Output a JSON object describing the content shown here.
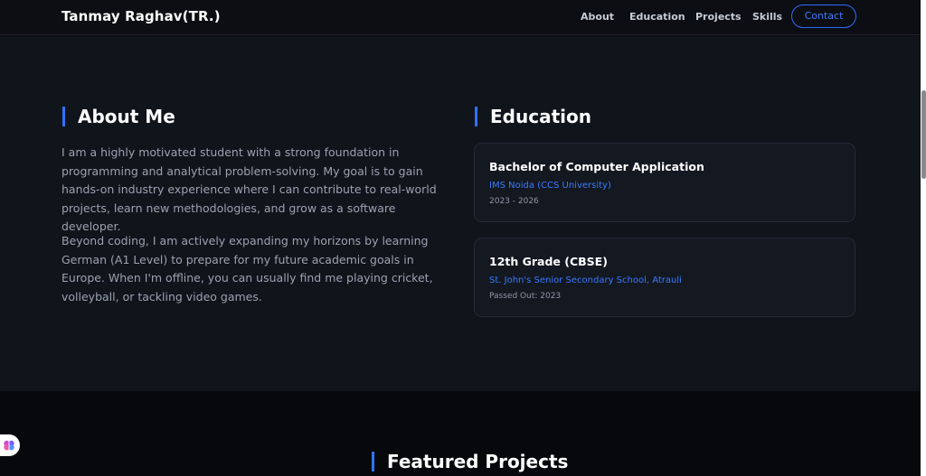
{
  "nav": {
    "brand": "Tanmay Raghav(TR.)",
    "links": [
      "About",
      "Education",
      "Projects",
      "Skills"
    ],
    "contact": "Contact"
  },
  "about": {
    "title": "About Me",
    "paragraphs": [
      "I am a highly motivated student with a strong foundation in programming and analytical problem-solving. My goal is to gain hands-on industry experience where I can contribute to real-world projects, learn new methodologies, and grow as a software developer.",
      "Beyond coding, I am actively expanding my horizons by learning German (A1 Level) to prepare for my future academic goals in Europe. When I'm offline, you can usually find me playing cricket, volleyball, or tackling video games."
    ]
  },
  "education": {
    "title": "Education",
    "items": [
      {
        "degree": "Bachelor of Computer Application",
        "school": "IMS Noida (CCS University)",
        "date": "2023 - 2026"
      },
      {
        "degree": "12th Grade (CBSE)",
        "school": "St. John's Senior Secondary School, Atrauli",
        "date": "Passed Out: 2023"
      }
    ]
  },
  "projects": {
    "title": "Featured Projects"
  },
  "colors": {
    "accent": "#2f73ff",
    "background": "#10141b",
    "card": "#131821"
  },
  "icons": {
    "floating_button": "brain-icon"
  }
}
